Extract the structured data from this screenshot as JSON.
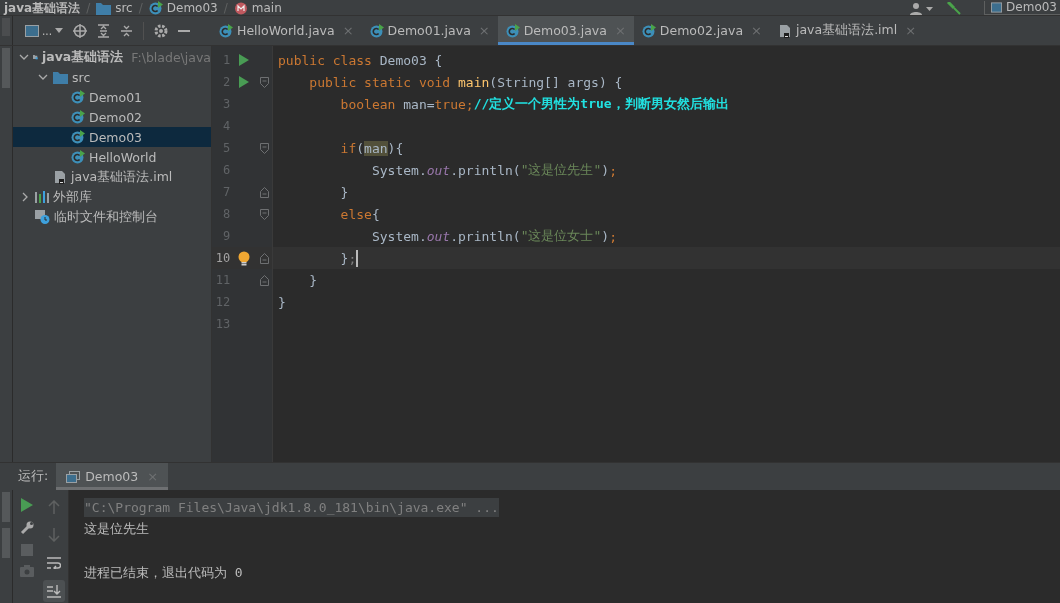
{
  "breadcrumb": [
    {
      "label": "java基础语法"
    },
    {
      "separator": "/",
      "label": "src",
      "kind": "folder"
    },
    {
      "separator": "/",
      "label": "Demo03",
      "kind": "class"
    },
    {
      "separator": "/",
      "label": "main",
      "kind": "method"
    }
  ],
  "top_right": {
    "run_config": "Demo03"
  },
  "project_toolbar": {
    "view_label": "..."
  },
  "tabs": [
    {
      "label": "HelloWorld.java",
      "kind": "class",
      "selected": false,
      "close": "×"
    },
    {
      "label": "Demo01.java",
      "kind": "class",
      "selected": false,
      "close": "×"
    },
    {
      "label": "Demo03.java",
      "kind": "class",
      "selected": true,
      "close": "×"
    },
    {
      "label": "Demo02.java",
      "kind": "class",
      "selected": false,
      "close": "×"
    },
    {
      "label": "java基础语法.iml",
      "kind": "file",
      "selected": false,
      "close": "×"
    }
  ],
  "tree": [
    {
      "label": "java基础语法",
      "hint": "F:\\blade\\java",
      "kind": "module",
      "expanded": true,
      "selected": false,
      "children": [
        {
          "label": "src",
          "kind": "folder",
          "expanded": true,
          "selected": false,
          "children": [
            {
              "label": "Demo01",
              "kind": "class",
              "selected": false
            },
            {
              "label": "Demo02",
              "kind": "class",
              "selected": false
            },
            {
              "label": "Demo03",
              "kind": "class",
              "selected": true
            },
            {
              "label": "HelloWorld",
              "kind": "class",
              "selected": false
            }
          ]
        },
        {
          "label": "java基础语法.iml",
          "kind": "file",
          "selected": false
        }
      ]
    },
    {
      "label": "外部库",
      "kind": "library",
      "expanded": false,
      "selected": false
    },
    {
      "label": "临时文件和控制台",
      "kind": "scratch",
      "selected": false
    }
  ],
  "code": [
    {
      "number": "1",
      "run": true,
      "fold_start": false,
      "fold_end": false,
      "bulb": false,
      "current": false,
      "tokens": [
        {
          "t": "public class ",
          "kind": "keyword"
        },
        {
          "t": "Demo03 {",
          "kind": "plain"
        }
      ]
    },
    {
      "number": "2",
      "run": true,
      "fold_start": true,
      "fold_end": false,
      "bulb": false,
      "current": false,
      "tokens": [
        {
          "t": "    public static void ",
          "kind": "keyword"
        },
        {
          "t": "main",
          "kind": "method"
        },
        {
          "t": "(String[] args) {",
          "kind": "plain"
        }
      ]
    },
    {
      "number": "3",
      "run": false,
      "fold_start": false,
      "fold_end": false,
      "bulb": false,
      "current": false,
      "tokens": [
        {
          "t": "        boolean ",
          "kind": "keyword"
        },
        {
          "t": "man=",
          "kind": "plain"
        },
        {
          "t": "true;",
          "kind": "keyword"
        },
        {
          "t": "//定义一个男性为true，判断男女然后输出",
          "kind": "comment"
        }
      ]
    },
    {
      "number": "4",
      "run": false,
      "fold_start": false,
      "fold_end": false,
      "bulb": false,
      "current": false
    },
    {
      "number": "5",
      "run": false,
      "fold_start": true,
      "fold_end": false,
      "bulb": false,
      "current": false,
      "tokens": [
        {
          "t": "        if",
          "kind": "keyword"
        },
        {
          "t": "(",
          "kind": "plain"
        },
        {
          "t": "man",
          "kind": "usage"
        },
        {
          "t": "){",
          "kind": "plain"
        }
      ]
    },
    {
      "number": "6",
      "run": false,
      "fold_start": false,
      "fold_end": false,
      "bulb": false,
      "current": false,
      "tokens": [
        {
          "t": "            System.",
          "kind": "plain"
        },
        {
          "t": "out",
          "kind": "field"
        },
        {
          "t": ".println(",
          "kind": "plain"
        },
        {
          "t": "\"这是位先生\"",
          "kind": "string"
        },
        {
          "t": ")",
          "kind": "plain"
        },
        {
          "t": ";",
          "kind": "keyword"
        }
      ]
    },
    {
      "number": "7",
      "run": false,
      "fold_start": false,
      "fold_end": true,
      "bulb": false,
      "current": false,
      "tokens": [
        {
          "t": "        }",
          "kind": "plain"
        }
      ]
    },
    {
      "number": "8",
      "run": false,
      "fold_start": true,
      "fold_end": false,
      "bulb": false,
      "current": false,
      "tokens": [
        {
          "t": "        else",
          "kind": "keyword"
        },
        {
          "t": "{",
          "kind": "plain"
        }
      ]
    },
    {
      "number": "9",
      "run": false,
      "fold_start": false,
      "fold_end": false,
      "bulb": false,
      "current": false,
      "tokens": [
        {
          "t": "            System.",
          "kind": "plain"
        },
        {
          "t": "out",
          "kind": "field"
        },
        {
          "t": ".println(",
          "kind": "plain"
        },
        {
          "t": "\"这是位女士\"",
          "kind": "string"
        },
        {
          "t": ")",
          "kind": "plain"
        },
        {
          "t": ";",
          "kind": "keyword"
        }
      ]
    },
    {
      "number": "10",
      "run": false,
      "fold_start": false,
      "fold_end": true,
      "bulb": true,
      "current": true,
      "tokens": [
        {
          "t": "        }",
          "kind": "plain"
        },
        {
          "t": ";",
          "kind": "dim"
        }
      ]
    },
    {
      "number": "11",
      "run": false,
      "fold_start": false,
      "fold_end": true,
      "bulb": false,
      "current": false,
      "tokens": [
        {
          "t": "    }",
          "kind": "plain"
        }
      ]
    },
    {
      "number": "12",
      "run": false,
      "fold_start": false,
      "fold_end": false,
      "bulb": false,
      "current": false,
      "tokens": [
        {
          "t": "}",
          "kind": "plain"
        }
      ]
    },
    {
      "number": "13",
      "run": false,
      "fold_start": false,
      "fold_end": false,
      "bulb": false,
      "current": false
    }
  ],
  "run_panel": {
    "label": "运行:",
    "tab": "Demo03",
    "close": "×",
    "output": [
      {
        "text": "\"C:\\Program Files\\Java\\jdk1.8.0_181\\bin\\java.exe\" ...",
        "kind": "command"
      },
      {
        "text": "这是位先生",
        "kind": "plain"
      },
      {
        "text": "进程已结束，退出代码为 0",
        "kind": "status"
      }
    ]
  }
}
